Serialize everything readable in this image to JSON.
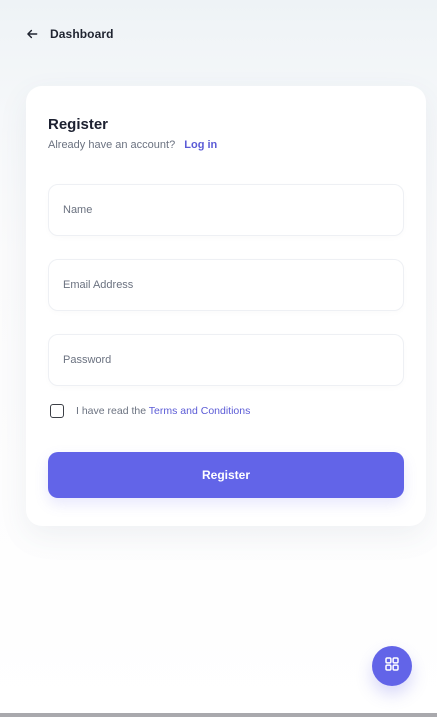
{
  "header": {
    "back_label": "Dashboard"
  },
  "register": {
    "title": "Register",
    "subtitle_prefix": "Already have an account?",
    "login_link": "Log in",
    "fields": {
      "name_placeholder": "Name",
      "email_placeholder": "Email Address",
      "password_placeholder": "Password"
    },
    "terms_prefix": "I have read the",
    "terms_link": "Terms and Conditions",
    "terms_checked": false,
    "submit_label": "Register"
  },
  "icons": {
    "back": "arrow-left",
    "fab": "grid-icon"
  },
  "colors": {
    "accent": "#6264e8",
    "link": "#5b5bd6",
    "text_primary": "#1c2030",
    "text_secondary": "#6b7280"
  }
}
